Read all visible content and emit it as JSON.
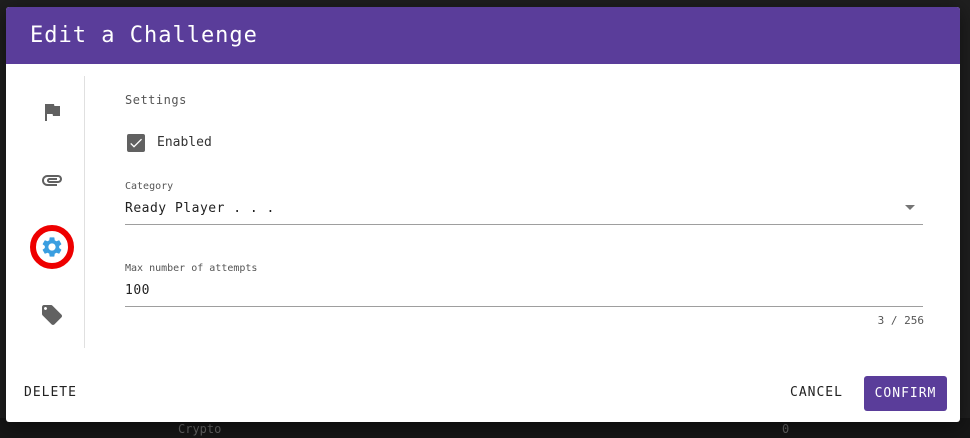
{
  "background": {
    "row_category": "Crypto",
    "row_value": "0"
  },
  "dialog": {
    "title": "Edit a Challenge",
    "header_color": "#5a3d9a"
  },
  "nav": {
    "items": [
      {
        "icon": "flag-icon"
      },
      {
        "icon": "paperclip-icon"
      },
      {
        "icon": "gear-icon",
        "active": true
      },
      {
        "icon": "tag-icon"
      }
    ]
  },
  "settings": {
    "section_title": "Settings",
    "enabled_label": "Enabled",
    "enabled": true,
    "category_label": "Category",
    "category_value": "Ready Player . . .",
    "attempts_label": "Max number of attempts",
    "attempts_value": "100",
    "attempts_counter": "3 / 256"
  },
  "actions": {
    "delete_label": "DELETE",
    "cancel_label": "CANCEL",
    "confirm_label": "CONFIRM"
  }
}
